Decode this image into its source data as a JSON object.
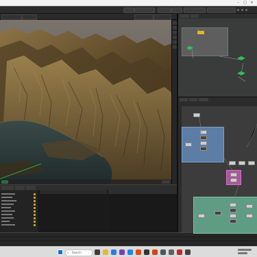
{
  "colors": {
    "accent_blue": "#5b7da6",
    "accent_green": "#5e9c84",
    "accent_pink": "#b052a0",
    "accent_yellow": "#e8b22a",
    "node_green": "#2fbf5a"
  },
  "titlebar": {
    "title": ""
  },
  "taskbar": {
    "search_placeholder": "Search"
  }
}
